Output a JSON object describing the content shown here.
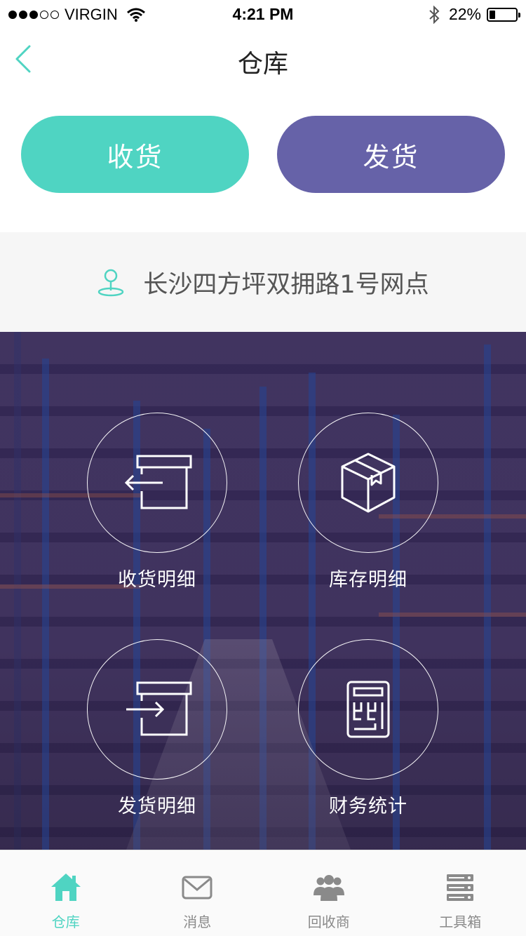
{
  "status_bar": {
    "carrier": "VIRGIN",
    "time": "4:21 PM",
    "battery": "22%",
    "battery_level": 0.22,
    "signal_bars": 3
  },
  "nav": {
    "title": "仓库",
    "back_icon": "chevron-left-icon"
  },
  "actions": {
    "receive_label": "收货",
    "ship_label": "发货"
  },
  "location": {
    "icon": "map-pin-icon",
    "text": "长沙四方坪双拥路1号网点"
  },
  "tiles": [
    {
      "label": "收货明细",
      "icon": "box-arrow-in-icon"
    },
    {
      "label": "库存明细",
      "icon": "package-icon"
    },
    {
      "label": "发货明细",
      "icon": "box-arrow-out-icon"
    },
    {
      "label": "财务统计",
      "icon": "calculator-icon"
    }
  ],
  "tab_bar": {
    "items": [
      {
        "label": "仓库",
        "icon": "home-icon",
        "active": true
      },
      {
        "label": "消息",
        "icon": "mail-icon",
        "active": false
      },
      {
        "label": "回收商",
        "icon": "users-icon",
        "active": false
      },
      {
        "label": "工具箱",
        "icon": "server-icon",
        "active": false
      }
    ]
  },
  "colors": {
    "accent_teal": "#4fd4c2",
    "accent_purple": "#6662a8",
    "tab_inactive": "#8a8a8a"
  }
}
